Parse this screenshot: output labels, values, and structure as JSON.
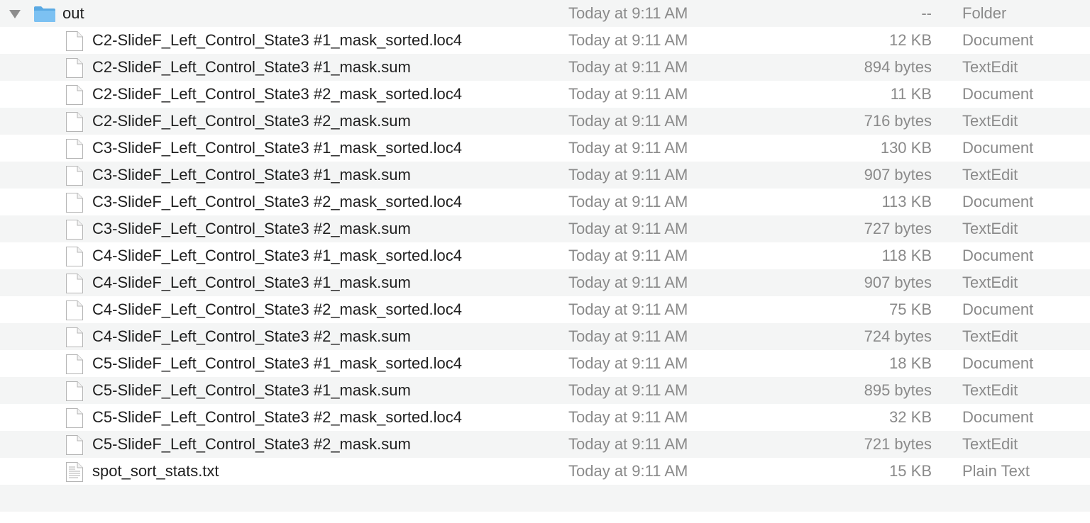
{
  "folder": {
    "name": "out",
    "date": "Today at 9:11 AM",
    "size": "--",
    "kind": "Folder",
    "icon": "folder-icon",
    "expanded": true
  },
  "files": [
    {
      "name": "C2-SlideF_Left_Control_State3 #1_mask_sorted.loc4",
      "date": "Today at 9:11 AM",
      "size": "12 KB",
      "kind": "Document",
      "icon": "document-icon"
    },
    {
      "name": "C2-SlideF_Left_Control_State3 #1_mask.sum",
      "date": "Today at 9:11 AM",
      "size": "894 bytes",
      "kind": "TextEdit",
      "icon": "document-icon"
    },
    {
      "name": "C2-SlideF_Left_Control_State3 #2_mask_sorted.loc4",
      "date": "Today at 9:11 AM",
      "size": "11 KB",
      "kind": "Document",
      "icon": "document-icon"
    },
    {
      "name": "C2-SlideF_Left_Control_State3 #2_mask.sum",
      "date": "Today at 9:11 AM",
      "size": "716 bytes",
      "kind": "TextEdit",
      "icon": "document-icon"
    },
    {
      "name": "C3-SlideF_Left_Control_State3 #1_mask_sorted.loc4",
      "date": "Today at 9:11 AM",
      "size": "130 KB",
      "kind": "Document",
      "icon": "document-icon"
    },
    {
      "name": "C3-SlideF_Left_Control_State3 #1_mask.sum",
      "date": "Today at 9:11 AM",
      "size": "907 bytes",
      "kind": "TextEdit",
      "icon": "document-icon"
    },
    {
      "name": "C3-SlideF_Left_Control_State3 #2_mask_sorted.loc4",
      "date": "Today at 9:11 AM",
      "size": "113 KB",
      "kind": "Document",
      "icon": "document-icon"
    },
    {
      "name": "C3-SlideF_Left_Control_State3 #2_mask.sum",
      "date": "Today at 9:11 AM",
      "size": "727 bytes",
      "kind": "TextEdit",
      "icon": "document-icon"
    },
    {
      "name": "C4-SlideF_Left_Control_State3 #1_mask_sorted.loc4",
      "date": "Today at 9:11 AM",
      "size": "118 KB",
      "kind": "Document",
      "icon": "document-icon"
    },
    {
      "name": "C4-SlideF_Left_Control_State3 #1_mask.sum",
      "date": "Today at 9:11 AM",
      "size": "907 bytes",
      "kind": "TextEdit",
      "icon": "document-icon"
    },
    {
      "name": "C4-SlideF_Left_Control_State3 #2_mask_sorted.loc4",
      "date": "Today at 9:11 AM",
      "size": "75 KB",
      "kind": "Document",
      "icon": "document-icon"
    },
    {
      "name": "C4-SlideF_Left_Control_State3 #2_mask.sum",
      "date": "Today at 9:11 AM",
      "size": "724 bytes",
      "kind": "TextEdit",
      "icon": "document-icon"
    },
    {
      "name": "C5-SlideF_Left_Control_State3 #1_mask_sorted.loc4",
      "date": "Today at 9:11 AM",
      "size": "18 KB",
      "kind": "Document",
      "icon": "document-icon"
    },
    {
      "name": "C5-SlideF_Left_Control_State3 #1_mask.sum",
      "date": "Today at 9:11 AM",
      "size": "895 bytes",
      "kind": "TextEdit",
      "icon": "document-icon"
    },
    {
      "name": "C5-SlideF_Left_Control_State3 #2_mask_sorted.loc4",
      "date": "Today at 9:11 AM",
      "size": "32 KB",
      "kind": "Document",
      "icon": "document-icon"
    },
    {
      "name": "C5-SlideF_Left_Control_State3 #2_mask.sum",
      "date": "Today at 9:11 AM",
      "size": "721 bytes",
      "kind": "TextEdit",
      "icon": "document-icon"
    },
    {
      "name": "spot_sort_stats.txt",
      "date": "Today at 9:11 AM",
      "size": "15 KB",
      "kind": "Plain Text",
      "icon": "text-file-icon"
    }
  ],
  "colors": {
    "row_alt": "#f4f5f5",
    "row_base": "#ffffff",
    "secondary_text": "#8a8a8a",
    "folder_blue": "#6cb8ee"
  }
}
